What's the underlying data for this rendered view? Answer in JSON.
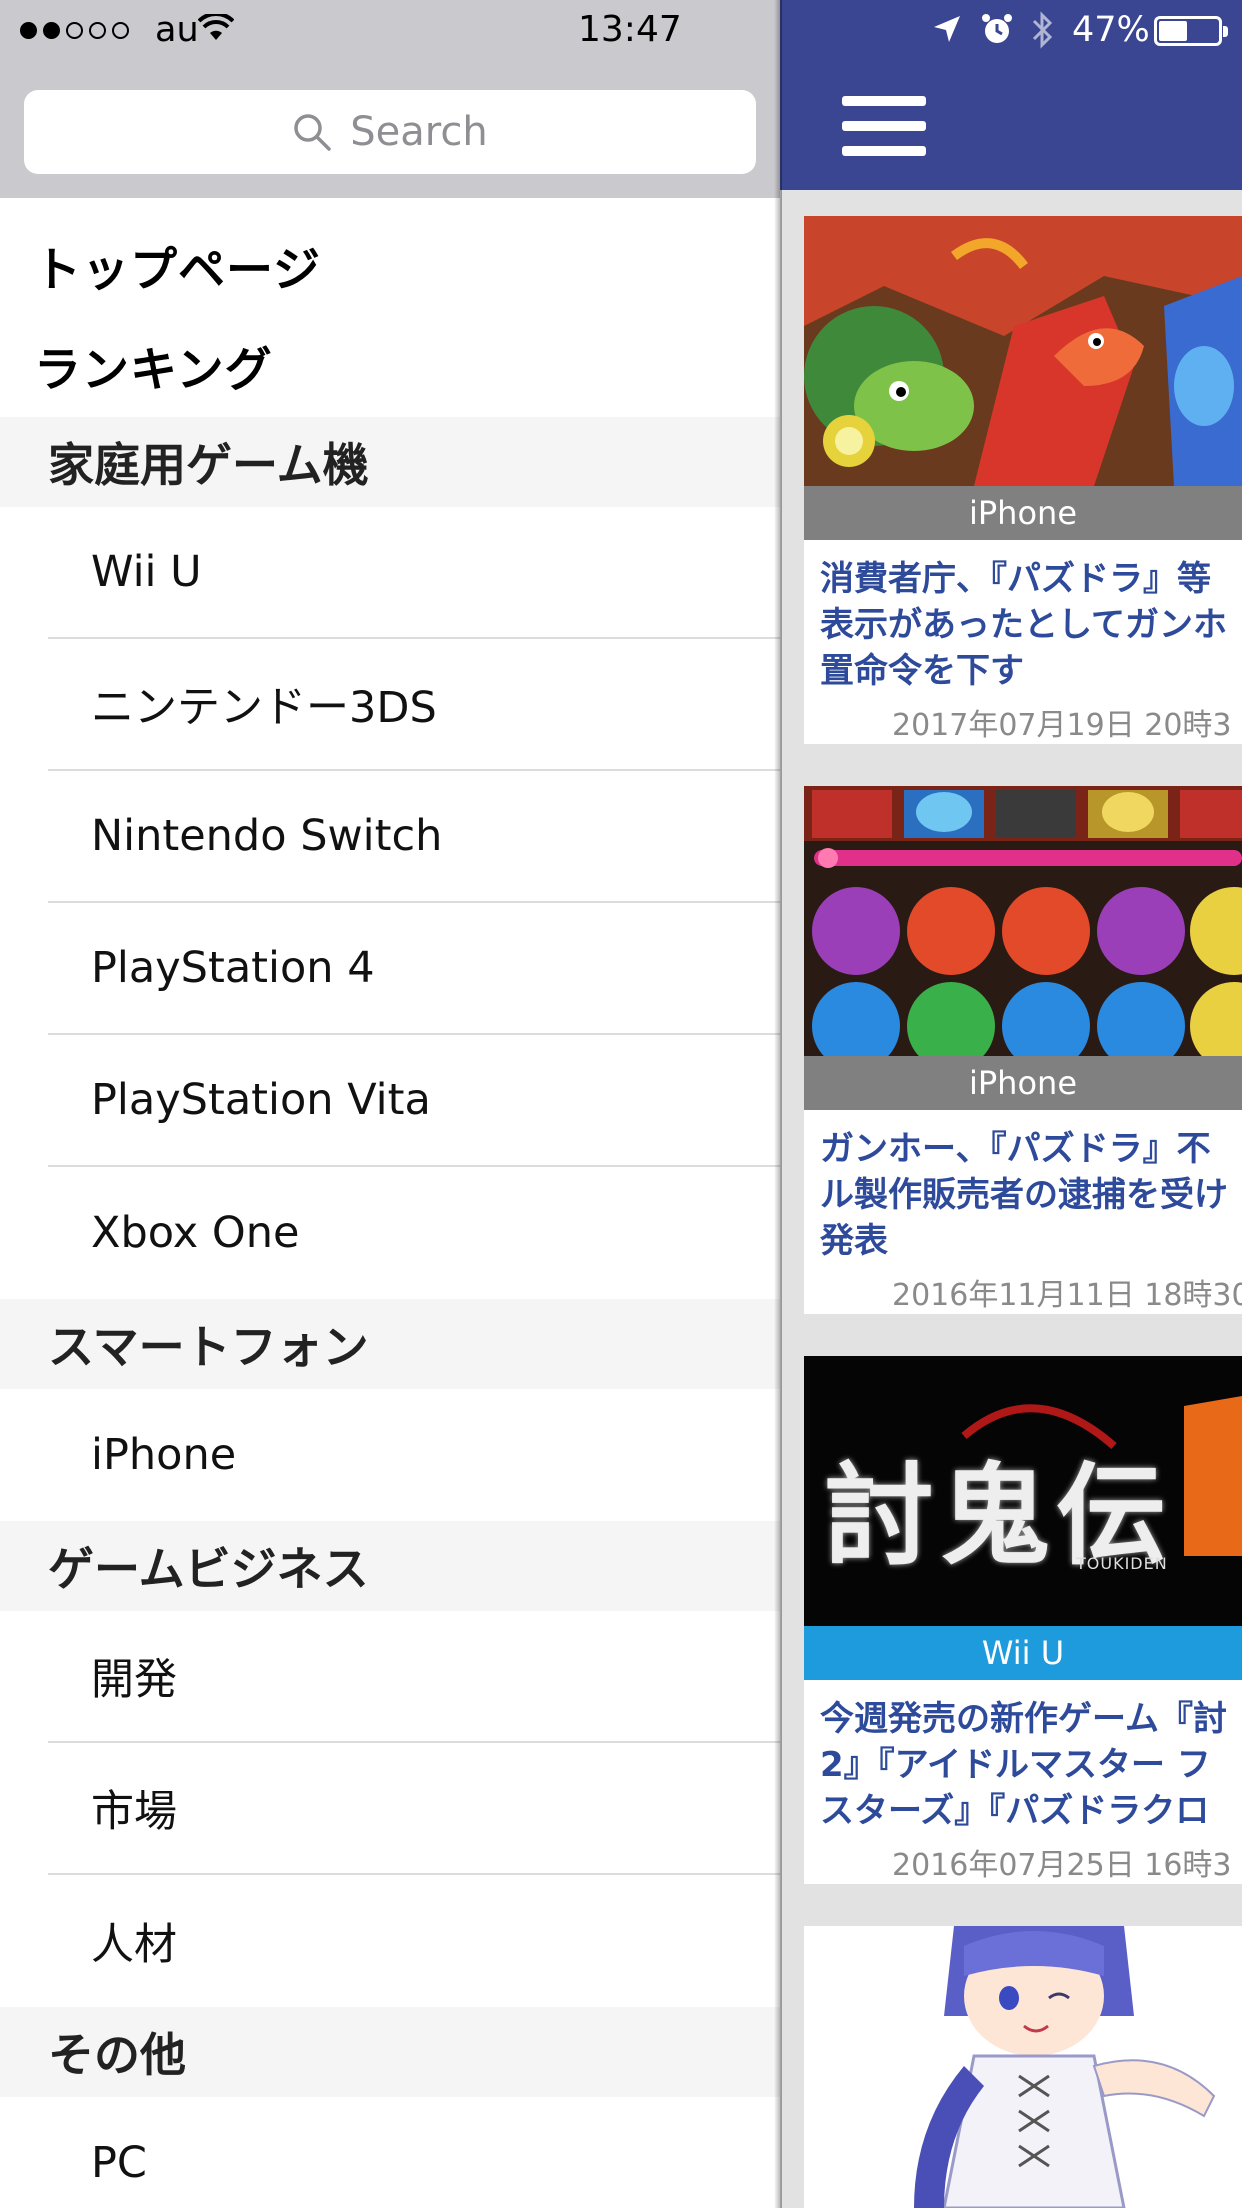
{
  "status_bar": {
    "carrier": "au",
    "time": "13:47",
    "battery": "47%",
    "signal_dots_filled": 2,
    "signal_dots_total": 5
  },
  "search": {
    "placeholder": "Search"
  },
  "menu": {
    "top_items": [
      "トップページ",
      "ランキング"
    ],
    "sections": [
      {
        "header": "家庭用ゲーム機",
        "items": [
          "Wii U",
          "ニンテンドー3DS",
          "Nintendo Switch",
          "PlayStation 4",
          "PlayStation Vita",
          "Xbox One"
        ]
      },
      {
        "header": "スマートフォン",
        "items": [
          "iPhone"
        ]
      },
      {
        "header": "ゲームビジネス",
        "items": [
          "開発",
          "市場",
          "人材"
        ]
      },
      {
        "header": "その他",
        "items": [
          "PC"
        ]
      }
    ]
  },
  "articles": [
    {
      "tag": "iPhone",
      "title_lines": [
        "消費者庁、『パズドラ』等",
        "表示があったとしてガンホ",
        "置命令を下す"
      ],
      "date": "2017年07月19日 20時3"
    },
    {
      "tag": "iPhone",
      "title_lines": [
        "ガンホー、『パズドラ』不",
        "ル製作販売者の逮捕を受け",
        "発表"
      ],
      "date": "2016年11月11日 18時30"
    },
    {
      "tag": "Wii U",
      "title_lines": [
        "今週発売の新作ゲーム『討",
        "2』『アイドルマスター フ",
        "スターズ』『パズドラクロ"
      ],
      "date": "2016年07月25日 16時3"
    }
  ],
  "thumb3_logo_text": "討鬼伝",
  "thumb3_logo_sub": "TOUKIDEN",
  "colors": {
    "navbar": "#3a4691",
    "link_title": "#2e4a9a",
    "tag_gray": "#808080",
    "tag_blue": "#1e9bdc"
  }
}
